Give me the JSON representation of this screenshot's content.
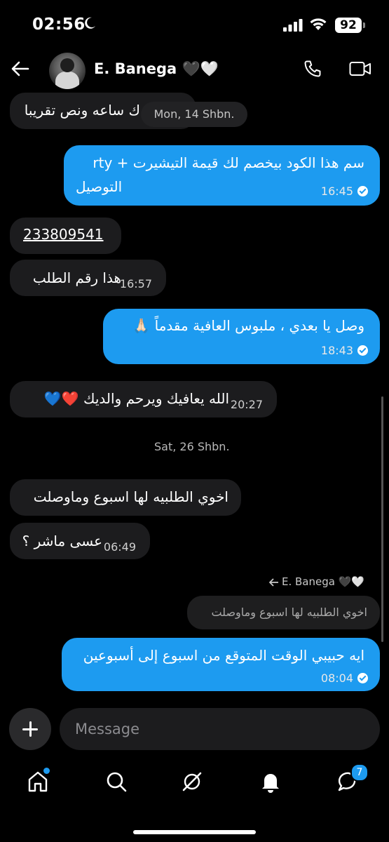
{
  "status": {
    "time": "02:56",
    "battery": "92"
  },
  "header": {
    "contact_name": "E. Banega 🖤🤍"
  },
  "messages": {
    "m1": {
      "text": "ك ساعه ونص تقريبا",
      "date_overlay": "Mon, 14 Shbn."
    },
    "m2": {
      "line1": "سم هذا الكود بيخصم لك قيمة التيشيرت + rty",
      "line2": "التوصيل",
      "time": "16:45"
    },
    "m3": {
      "text": "233809541"
    },
    "m4": {
      "text": "هذا  رقم الطلب",
      "time": "16:57"
    },
    "m5": {
      "text": "وصل يا بعدي ، ملبوس العافية مقدماً 🙏🏻",
      "time": "18:43"
    },
    "m6": {
      "text": "الله يعافيك ويرحم والديك ❤️💙",
      "time": "20:27"
    },
    "date_separator": "Sat, 26 Shbn.",
    "m7": {
      "text": "اخوي الطلبيه لها اسبوع وماوصلت"
    },
    "m8": {
      "text": "عسى ماشر ؟",
      "time": "06:49"
    },
    "reply": {
      "label": "E. Banega 🖤🤍",
      "quote": "اخوي الطلبيه لها اسبوع وماوصلت"
    },
    "m9": {
      "text": "ايه حبيبي الوقت المتوقع من اسبوع إلى أسبوعين",
      "time": "08:04"
    }
  },
  "composer": {
    "placeholder": "Message"
  },
  "tabbar": {
    "messages_badge": "7"
  }
}
